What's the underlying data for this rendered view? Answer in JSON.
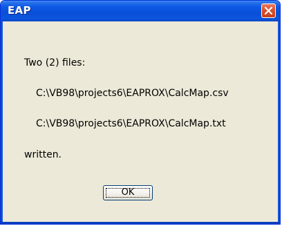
{
  "window": {
    "title": "EAP"
  },
  "message": {
    "line1": "Two (2) files:",
    "line2": "C:\\VB98\\projects6\\EAPROX\\CalcMap.csv",
    "line3": "C:\\VB98\\projects6\\EAPROX\\CalcMap.txt",
    "line4": "written."
  },
  "buttons": {
    "ok_label": "OK"
  },
  "icons": {
    "close": "close-icon"
  },
  "colors": {
    "titlebar": "#0a4fd8",
    "dialog_bg": "#ece9d8",
    "close_button": "#d8512c"
  }
}
